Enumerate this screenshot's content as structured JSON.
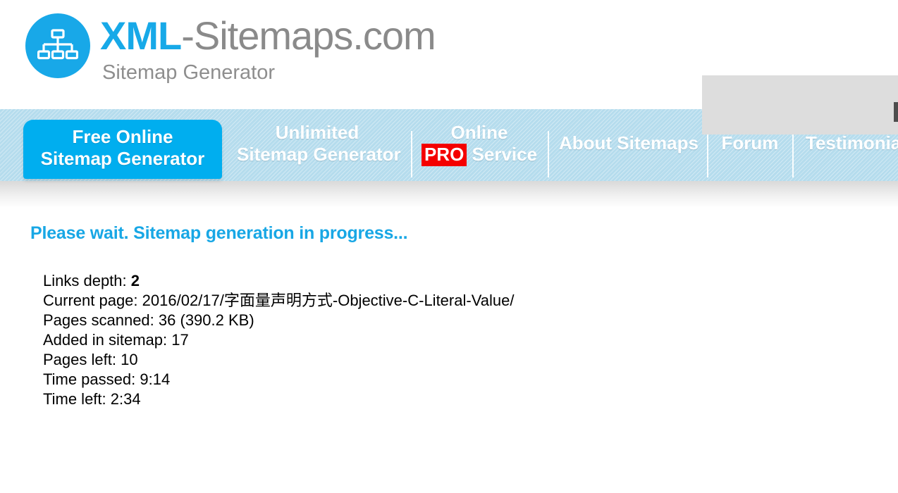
{
  "site": {
    "logo": {
      "icon": "sitemap-tree-icon",
      "title_accent": "XML",
      "title_rest": "-Sitemaps.com",
      "subtitle": "Sitemap Generator",
      "accent_color": "#17a9e8",
      "muted_color": "#8a8a8a"
    }
  },
  "nav": {
    "active_tab": {
      "label": "Free Online\nSitemap Generator",
      "line1": "Free Online",
      "line2": "Sitemap Generator"
    },
    "items": [
      {
        "id": "unlimited-sitemap-generator",
        "line1": "Unlimited",
        "line2": "Sitemap Generator"
      },
      {
        "id": "online-pro-service",
        "line1": "Online",
        "badge": "PRO",
        "line2_after_badge": " Service"
      },
      {
        "id": "about-sitemaps",
        "label": "About Sitemaps"
      },
      {
        "id": "forum",
        "label": "Forum"
      },
      {
        "id": "testimonials",
        "label": "Testimonia"
      }
    ],
    "colors": {
      "bar": "#b5dced",
      "active_tab": "#00aeef",
      "pro_badge": "#f40000"
    }
  },
  "main": {
    "heading": "Please wait. Sitemap generation in progress...",
    "heading_color": "#18a7e5",
    "status": [
      {
        "label": "Links depth:",
        "value": "2",
        "bold_value": true
      },
      {
        "label": "Current page:",
        "value": "2016/02/17/字面量声明方式-Objective-C-Literal-Value/",
        "bold_value": false
      },
      {
        "label": "Pages scanned:",
        "value": "36 (390.2 KB)",
        "bold_value": false
      },
      {
        "label": "Added in sitemap:",
        "value": "17",
        "bold_value": false
      },
      {
        "label": "Pages left:",
        "value": "10",
        "bold_value": false
      },
      {
        "label": "Time passed:",
        "value": "9:14",
        "bold_value": false
      },
      {
        "label": "Time left:",
        "value": "2:34",
        "bold_value": false
      }
    ]
  },
  "ad_placeholder": {
    "name": "advertisement-placeholder",
    "color": "#dddddd"
  }
}
